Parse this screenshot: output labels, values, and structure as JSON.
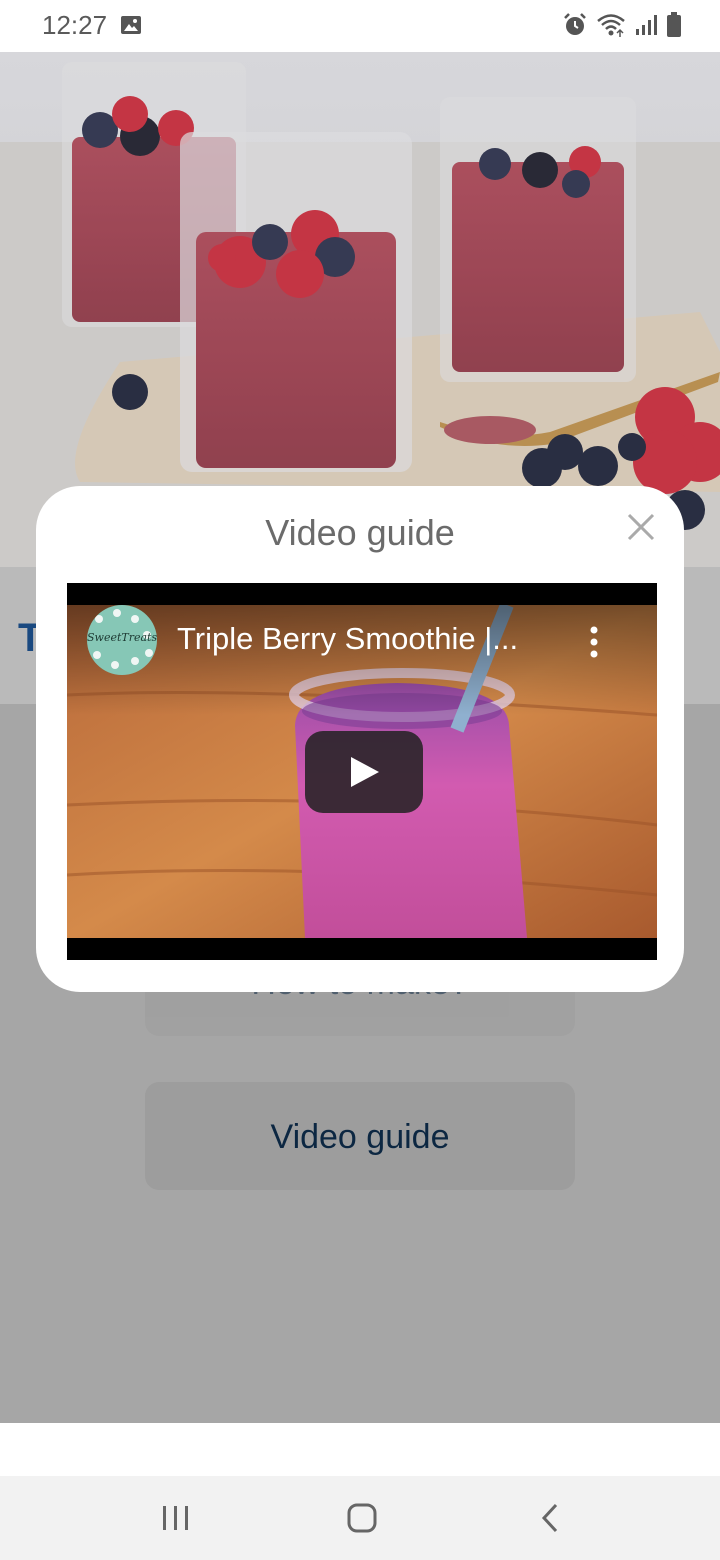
{
  "status_bar": {
    "time": "12:27",
    "left_icons": [
      "image-icon"
    ],
    "right_icons": [
      "alarm-icon",
      "wifi-icon",
      "signal-icon",
      "battery-icon"
    ]
  },
  "recipe": {
    "title_partial": "T",
    "hero_icon": "smoothie-photo"
  },
  "buttons": {
    "how_to_make": "How to make?",
    "video_guide": "Video guide"
  },
  "dialog": {
    "title": "Video guide",
    "close_icon": "close-icon"
  },
  "video": {
    "title": "Triple Berry Smoothie |...",
    "channel": "SweetTreats",
    "play_icon": "play-icon",
    "menu_icon": "more-vert-icon"
  },
  "nav_bar": {
    "icons": [
      "recent-apps-icon",
      "home-icon",
      "back-icon"
    ]
  },
  "colors": {
    "title_blue": "#1c4f8a",
    "button_text": "#0d2a47",
    "dim_background": "#b3b3b3"
  }
}
